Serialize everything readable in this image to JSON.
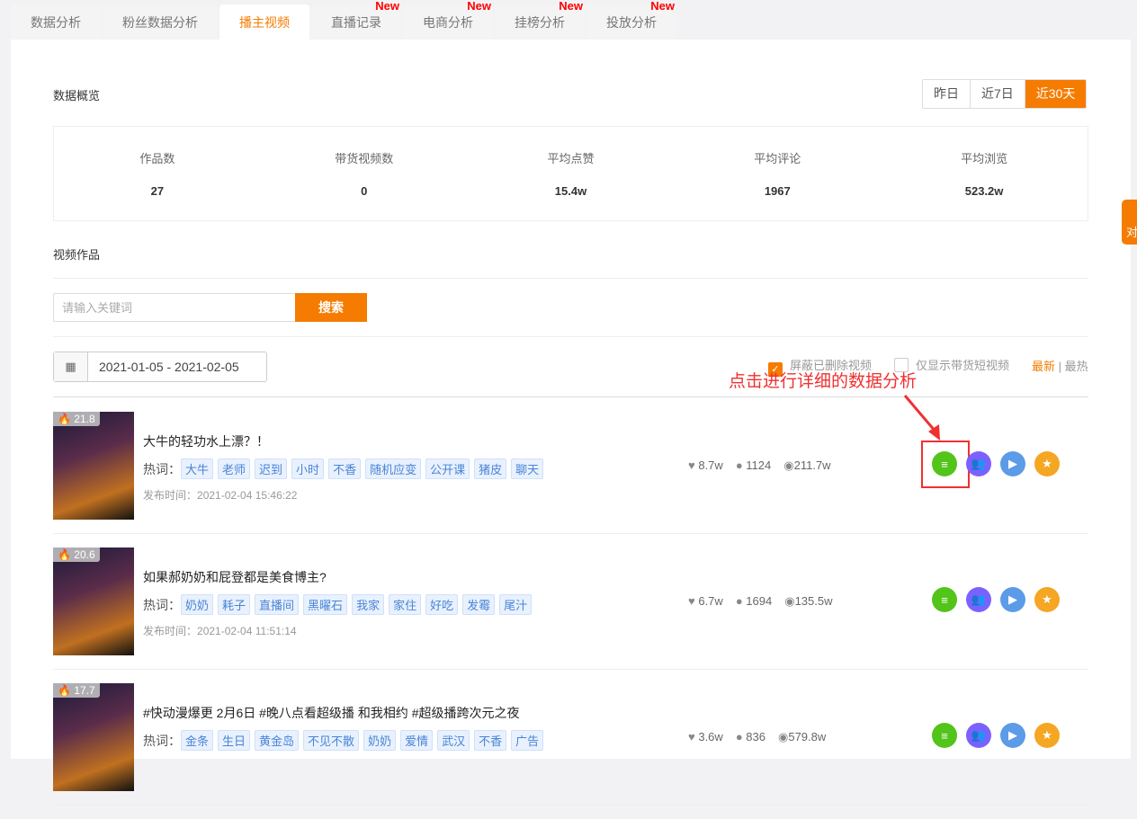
{
  "tabs": [
    {
      "label": "数据分析"
    },
    {
      "label": "粉丝数据分析"
    },
    {
      "label": "播主视频",
      "active": true
    },
    {
      "label": "直播记录",
      "badge": "New"
    },
    {
      "label": "电商分析",
      "badge": "New"
    },
    {
      "label": "挂榜分析",
      "badge": "New"
    },
    {
      "label": "投放分析",
      "badge": "New"
    }
  ],
  "overview": {
    "title": "数据概览",
    "ranges": [
      "昨日",
      "近7日",
      "近30天"
    ],
    "selected_range": "近30天",
    "metrics": [
      {
        "label": "作品数",
        "value": "27"
      },
      {
        "label": "带货视频数",
        "value": "0"
      },
      {
        "label": "平均点赞",
        "value": "15.4w"
      },
      {
        "label": "平均评论",
        "value": "1967"
      },
      {
        "label": "平均浏览",
        "value": "523.2w"
      }
    ]
  },
  "videos_section": {
    "title": "视频作品",
    "search_placeholder": "请输入关键词",
    "search_button": "搜索",
    "date_range": "2021-01-05 - 2021-02-05",
    "filter_hide_deleted": "屏蔽已删除视频",
    "filter_hide_deleted_checked": true,
    "filter_goods_only": "仅显示带货短视频",
    "filter_goods_only_checked": false,
    "sort_latest": "最新",
    "sort_sep": "|",
    "sort_hot": "最热",
    "sort_selected": "最新"
  },
  "annotation": {
    "text": "点击进行详细的数据分析",
    "color": "#f03030"
  },
  "side_tab": {
    "label": "对"
  },
  "keyword_label": "热词：",
  "publish_label": "发布时间：",
  "videos": [
    {
      "heat": "21.8",
      "title": "大牛的轻功水上漂？！",
      "keywords": [
        "大牛",
        "老师",
        "迟到",
        "小时",
        "不香",
        "随机应变",
        "公开课",
        "猪皮",
        "聊天"
      ],
      "published": "2021-02-04 15:46:22",
      "likes": "8.7w",
      "comments": "1124",
      "views": "211.7w"
    },
    {
      "heat": "20.6",
      "title": "如果郝奶奶和屁登都是美食博主?",
      "keywords": [
        "奶奶",
        "耗子",
        "直播间",
        "黑曜石",
        "我家",
        "家住",
        "好吃",
        "发霉",
        "尾汁"
      ],
      "published": "2021-02-04 11:51:14",
      "likes": "6.7w",
      "comments": "1694",
      "views": "135.5w"
    },
    {
      "heat": "17.7",
      "title": "#快动漫爆更 2月6日 #晚八点看超级播 和我相约 #超级播跨次元之夜",
      "keywords": [
        "金条",
        "生日",
        "黄金岛",
        "不见不散",
        "奶奶",
        "爱情",
        "武汉",
        "不香",
        "广告"
      ],
      "published": "",
      "likes": "3.6w",
      "comments": "836",
      "views": "579.8w"
    }
  ],
  "colors": {
    "accent": "#f57c00",
    "analysis": "#52c41a",
    "fans": "#7b61ff",
    "play": "#5b9be8",
    "favorite": "#f5a623"
  },
  "action_icons": [
    "list-icon",
    "users-icon",
    "play-icon",
    "star-icon"
  ]
}
